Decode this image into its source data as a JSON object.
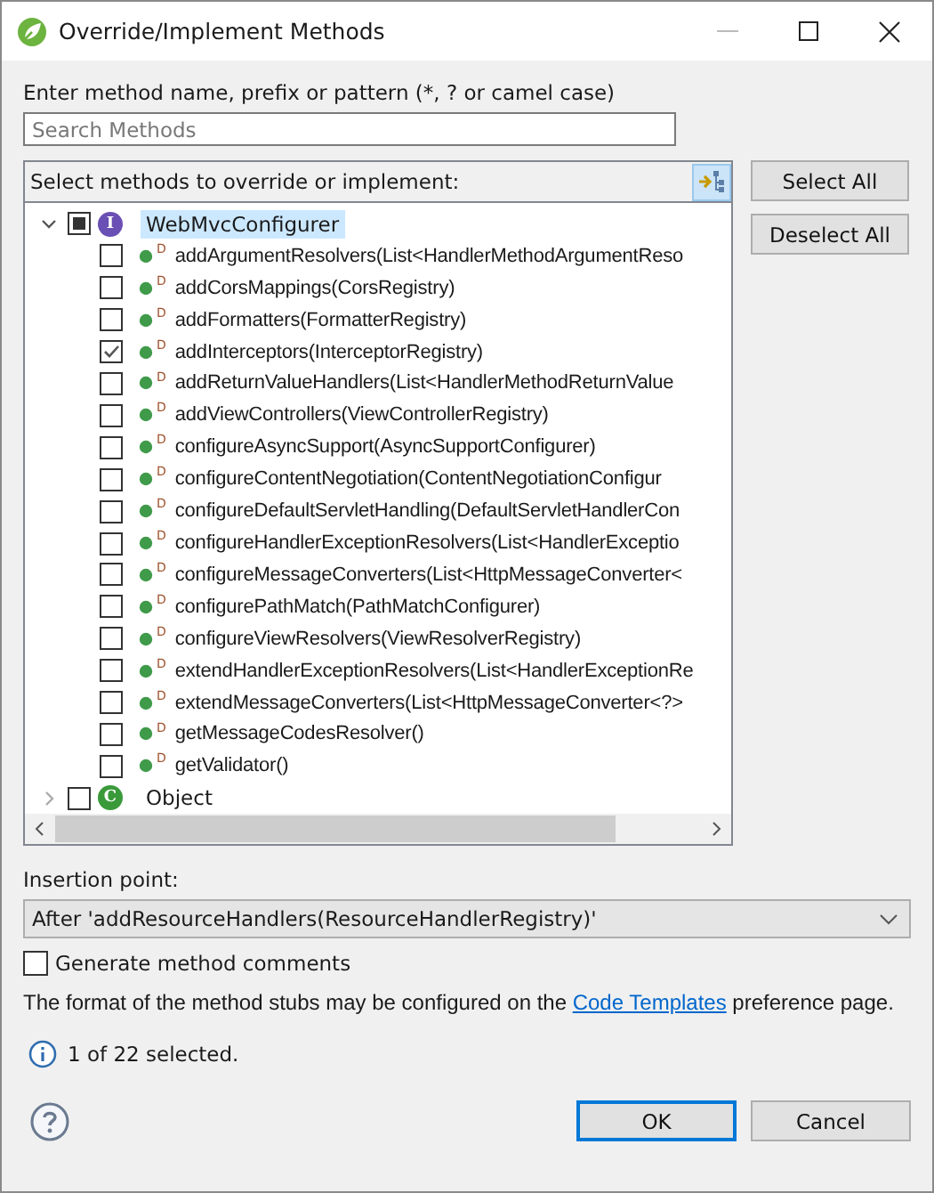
{
  "window": {
    "title": "Override/Implement Methods"
  },
  "filter": {
    "label": "Enter method name, prefix or pattern (*, ? or camel case)",
    "placeholder": "Search Methods"
  },
  "methods_header": {
    "label": "Select methods to override or implement:",
    "group_toggle_on": true
  },
  "tree": [
    {
      "label": "WebMvcConfigurer",
      "badge": "I",
      "kind": "interface",
      "expanded": true,
      "checked": false,
      "partial": true,
      "selected": true,
      "children": [
        {
          "label": "addArgumentResolvers(List<HandlerMethodArgumentReso",
          "decoration": "D",
          "checked": false
        },
        {
          "label": "addCorsMappings(CorsRegistry)",
          "decoration": "D",
          "checked": false
        },
        {
          "label": "addFormatters(FormatterRegistry)",
          "decoration": "D",
          "checked": false
        },
        {
          "label": "addInterceptors(InterceptorRegistry)",
          "decoration": "D",
          "checked": true
        },
        {
          "label": "addReturnValueHandlers(List<HandlerMethodReturnValue",
          "decoration": "D",
          "checked": false
        },
        {
          "label": "addViewControllers(ViewControllerRegistry)",
          "decoration": "D",
          "checked": false
        },
        {
          "label": "configureAsyncSupport(AsyncSupportConfigurer)",
          "decoration": "D",
          "checked": false
        },
        {
          "label": "configureContentNegotiation(ContentNegotiationConfigur",
          "decoration": "D",
          "checked": false
        },
        {
          "label": "configureDefaultServletHandling(DefaultServletHandlerCon",
          "decoration": "D",
          "checked": false
        },
        {
          "label": "configureHandlerExceptionResolvers(List<HandlerExceptio",
          "decoration": "D",
          "checked": false
        },
        {
          "label": "configureMessageConverters(List<HttpMessageConverter<",
          "decoration": "D",
          "checked": false
        },
        {
          "label": "configurePathMatch(PathMatchConfigurer)",
          "decoration": "D",
          "checked": false
        },
        {
          "label": "configureViewResolvers(ViewResolverRegistry)",
          "decoration": "D",
          "checked": false
        },
        {
          "label": "extendHandlerExceptionResolvers(List<HandlerExceptionRe",
          "decoration": "D",
          "checked": false
        },
        {
          "label": "extendMessageConverters(List<HttpMessageConverter<?>",
          "decoration": "D",
          "checked": false
        },
        {
          "label": "getMessageCodesResolver()",
          "decoration": "D",
          "checked": false
        },
        {
          "label": "getValidator()",
          "decoration": "D",
          "checked": false
        }
      ]
    },
    {
      "label": "Object",
      "badge": "C",
      "kind": "class",
      "expanded": false,
      "checked": false,
      "partial": false,
      "selected": false
    }
  ],
  "side_buttons": [
    "Select All",
    "Deselect All"
  ],
  "insertion": {
    "label": "Insertion point:",
    "value": "After 'addResourceHandlers(ResourceHandlerRegistry)'"
  },
  "generate_comments": {
    "label": "Generate method comments",
    "checked": false
  },
  "note": {
    "before": "The format of the method stubs may be configured on the ",
    "link": "Code Templates",
    "after": " preference page."
  },
  "status": "1 of 22 selected.",
  "buttons": [
    {
      "label": "OK",
      "default": true
    },
    {
      "label": "Cancel",
      "default": false
    }
  ]
}
